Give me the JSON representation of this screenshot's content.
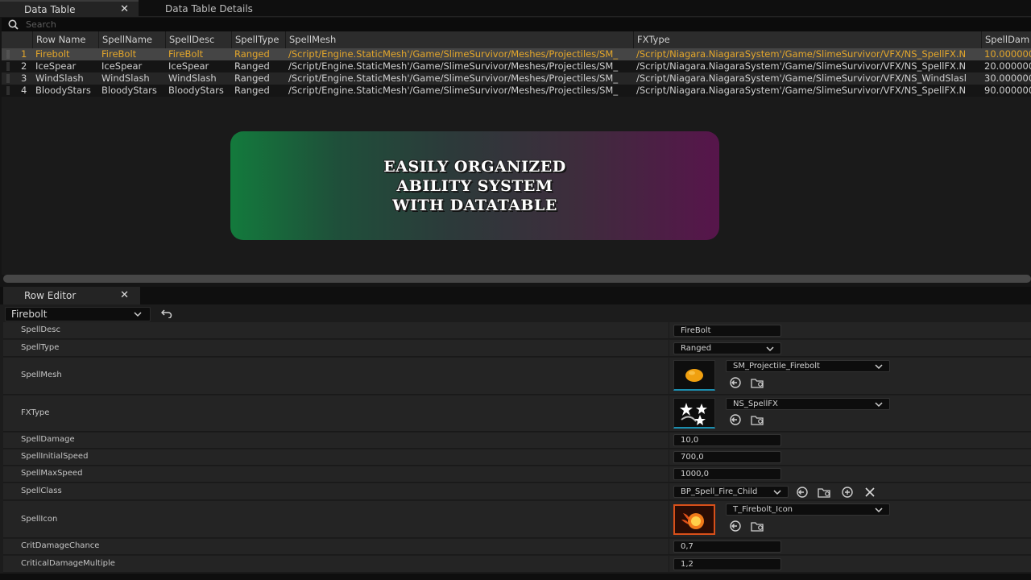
{
  "tabs": {
    "data_table": "Data Table",
    "data_table_details": "Data Table Details",
    "close_glyph": "✕"
  },
  "search": {
    "placeholder": "Search"
  },
  "table": {
    "columns": [
      "Row Name",
      "SpellName",
      "SpellDesc",
      "SpellType",
      "SpellMesh",
      "FXType",
      "SpellDam"
    ],
    "rows": [
      [
        "1",
        "Firebolt",
        "FireBolt",
        "FireBolt",
        "Ranged",
        "/Script/Engine.StaticMesh'/Game/SlimeSurvivor/Meshes/Projectiles/SM_",
        "/Script/Niagara.NiagaraSystem'/Game/SlimeSurvivor/VFX/NS_SpellFX.N",
        "10.000000"
      ],
      [
        "2",
        "IceSpear",
        "IceSpear",
        "IceSpear",
        "Ranged",
        "/Script/Engine.StaticMesh'/Game/SlimeSurvivor/Meshes/Projectiles/SM_",
        "/Script/Niagara.NiagaraSystem'/Game/SlimeSurvivor/VFX/NS_SpellFX.N",
        "20.000000"
      ],
      [
        "3",
        "WindSlash",
        "WindSlash",
        "WindSlash",
        "Ranged",
        "/Script/Engine.StaticMesh'/Game/SlimeSurvivor/Meshes/Projectiles/SM_",
        "/Script/Niagara.NiagaraSystem'/Game/SlimeSurvivor/VFX/NS_WindSlasl",
        "30.000000"
      ],
      [
        "4",
        "BloodyStars",
        "BloodyStars",
        "BloodyStars",
        "Ranged",
        "/Script/Engine.StaticMesh'/Game/SlimeSurvivor/Meshes/Projectiles/SM_",
        "/Script/Niagara.NiagaraSystem'/Game/SlimeSurvivor/VFX/NS_SpellFX.N",
        "90.000000"
      ]
    ]
  },
  "banner": {
    "line1": "EASILY ORGANIZED",
    "line2": "ABILITY SYSTEM",
    "line3": "WITH DATATABLE"
  },
  "row_editor": {
    "tab_label": "Row Editor",
    "selected_row": "Firebolt",
    "properties": {
      "spell_desc": {
        "label": "SpellDesc",
        "value": "FireBolt"
      },
      "spell_type": {
        "label": "SpellType",
        "value": "Ranged"
      },
      "spell_mesh": {
        "label": "SpellMesh",
        "value": "SM_Projectile_Firebolt"
      },
      "fx_type": {
        "label": "FXType",
        "value": "NS_SpellFX"
      },
      "spell_damage": {
        "label": "SpellDamage",
        "value": "10,0"
      },
      "spell_initial_speed": {
        "label": "SpellInitialSpeed",
        "value": "700,0"
      },
      "spell_max_speed": {
        "label": "SpellMaxSpeed",
        "value": "1000,0"
      },
      "spell_class": {
        "label": "SpellClass",
        "value": "BP_Spell_Fire_Child"
      },
      "spell_icon": {
        "label": "SpellIcon",
        "value": "T_Firebolt_Icon"
      },
      "crit_damage_chance": {
        "label": "CritDamageChance",
        "value": "0,7"
      },
      "critical_damage_multiple": {
        "label": "CriticalDamageMultiple",
        "value": "1,2"
      }
    }
  },
  "colors": {
    "selected_row_text": "#e3a62b",
    "thumb_accent": "#1c8fb0",
    "banner_left": "#137a3c",
    "banner_right": "#57154b"
  },
  "icons": [
    "search-icon",
    "close-icon",
    "chevron-down-icon",
    "reset-arrow-icon",
    "use-selected-icon",
    "browse-icon",
    "add-icon",
    "clear-icon",
    "orange-sphere-icon",
    "stars-fx-icon",
    "fireball-icon"
  ]
}
